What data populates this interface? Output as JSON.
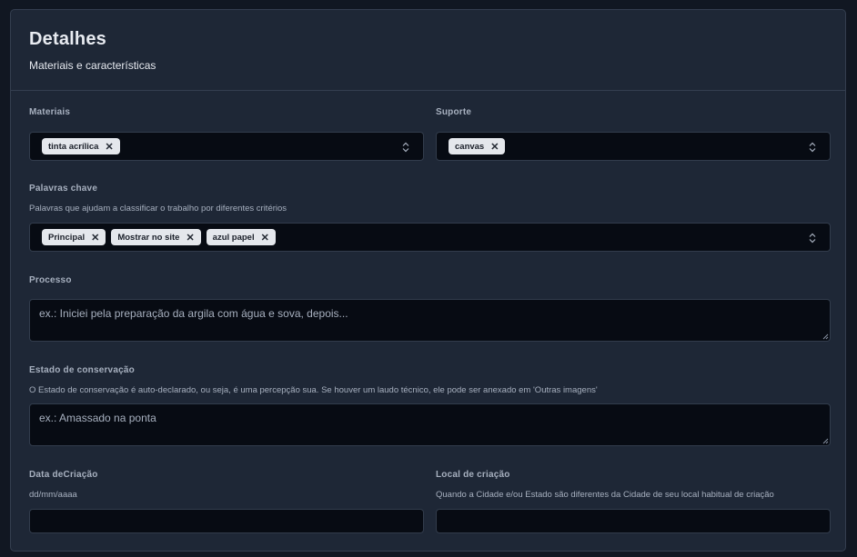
{
  "header": {
    "title": "Detalhes",
    "subtitle": "Materiais e características"
  },
  "materiais": {
    "label": "Materiais",
    "tags": [
      "tinta acrílica"
    ]
  },
  "suporte": {
    "label": "Suporte",
    "tags": [
      "canvas"
    ]
  },
  "palavras": {
    "label": "Palavras chave",
    "help": "Palavras que ajudam a classificar o trabalho por diferentes critérios",
    "tags": [
      "Principal",
      "Mostrar no site",
      "azul papel"
    ]
  },
  "processo": {
    "label": "Processo",
    "placeholder": "ex.: Iniciei pela preparação da argila com água e sova, depois..."
  },
  "estado": {
    "label": "Estado de conservação",
    "help": "O Estado de conservação é auto-declarado, ou seja, é uma percepção sua. Se houver um laudo técnico, ele pode ser anexado em 'Outras imagens'",
    "placeholder": "ex.: Amassado na ponta"
  },
  "data_criacao": {
    "label": "Data deCriação",
    "help": "dd/mm/aaaa",
    "value": ""
  },
  "local_criacao": {
    "label": "Local de criação",
    "help": "Quando a Cidade e/ou Estado são diferentes da Cidade de seu local habitual de criação",
    "value": ""
  },
  "icons": {
    "remove": "close-icon",
    "select": "chevron-up-down-icon",
    "resize": "resize-grip-icon"
  }
}
